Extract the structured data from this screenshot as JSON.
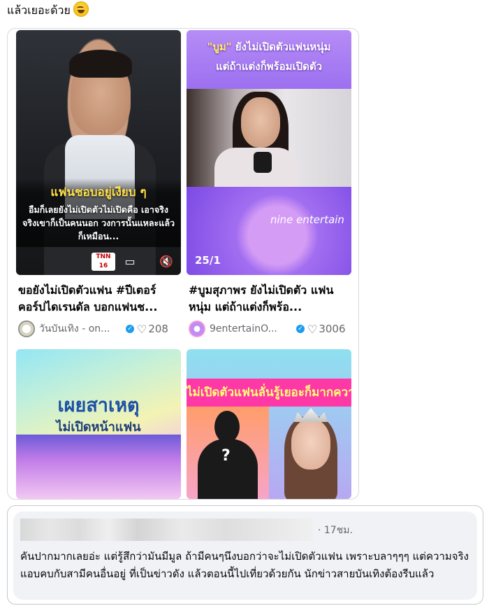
{
  "post": {
    "text": "แล้วเยอะด้วย",
    "emoji": "joy-emoji"
  },
  "feed": [
    {
      "overlay_title": "แฟนชอบอยู่เงียบ ๆ",
      "overlay_body": "อืมก็เลยยังไม่เปิดตัวไม่เปิดคือ เอาจริงจริงเขาก็เป็นคนนอก วงการนั้นแหละแล้วก็เหมือน...",
      "channel_logo": "TNN 16",
      "title": "ขอยังไม่เปิดตัวแฟน #ปีเตอร์ คอร์ปไดเรนดัล บอกแฟนช...",
      "author": "วันบันเทิง - on...",
      "likes": "208"
    },
    {
      "banner_highlight": "\"บูม\"",
      "banner_line1_rest": " ยังไม่เปิดตัวแฟนหนุ่ม",
      "banner_line2": "แต่ถ้าแต่งก็พร้อมเปิดตัว",
      "brand": "nine entertain",
      "counter": "25/1",
      "title": "#บูมสุภาพร ยังไม่เปิดตัว แฟนหนุ่ม แต่ถ้าแต่งก็พร้อ...",
      "author": "9entertainO...",
      "likes": "3006"
    },
    {
      "headline": "เผยสาเหตุ",
      "subline": "ไม่เปิดหน้าแฟน"
    },
    {
      "band": "ไม่เปิดตัวแฟนลั่นรู้เยอะก็มากความ",
      "silhouette_mark": "?"
    }
  ],
  "comment": {
    "time": "· 17ชม.",
    "text": "คันปากมากเลยอ่ะ แต่รู้สึกว่ามันมีมูล ถ้ามีคนๆนึงบอกว่าจะไม่เปิดตัวแฟน เพราะบลาๆๆๆ แต่ความจริงแอบคบกับสามีคนอื่นอยู่ ที่เป็นข่าวดัง แล้วตอนนี้ไปเที่ยวด้วยกัน นักข่าวสายบันเทิงต้องรีบแล้ว"
  },
  "colors": {
    "verified": "#1b9cf0",
    "band_pink": "#ff38a8",
    "headline_blue": "#1d4fa3"
  }
}
